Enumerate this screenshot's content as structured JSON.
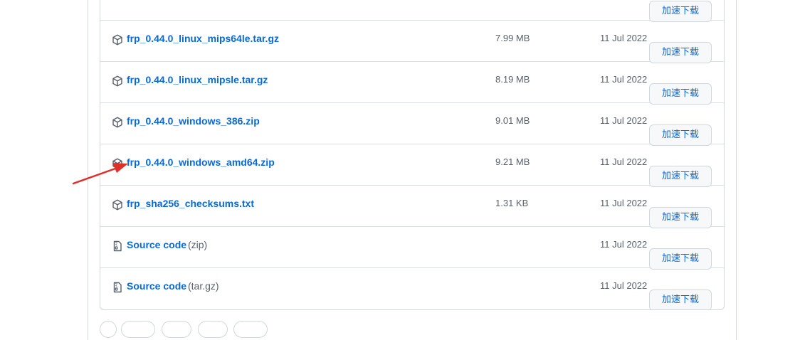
{
  "assets": {
    "partial_top_button_label": "加速下载",
    "rows": [
      {
        "name": "frp_0.44.0_linux_mips64le.tar.gz",
        "size": "7.99 MB",
        "date": "11 Jul 2022",
        "button_label": "加速下载",
        "icon": "package-icon"
      },
      {
        "name": "frp_0.44.0_linux_mipsle.tar.gz",
        "size": "8.19 MB",
        "date": "11 Jul 2022",
        "button_label": "加速下载",
        "icon": "package-icon"
      },
      {
        "name": "frp_0.44.0_windows_386.zip",
        "size": "9.01 MB",
        "date": "11 Jul 2022",
        "button_label": "加速下载",
        "icon": "package-icon"
      },
      {
        "name": "frp_0.44.0_windows_amd64.zip",
        "size": "9.21 MB",
        "date": "11 Jul 2022",
        "button_label": "加速下载",
        "icon": "package-icon"
      },
      {
        "name": "frp_sha256_checksums.txt",
        "size": "1.31 KB",
        "date": "11 Jul 2022",
        "button_label": "加速下载",
        "icon": "package-icon"
      },
      {
        "name": "Source code",
        "ext": "(zip)",
        "date": "11 Jul 2022",
        "button_label": "加速下载",
        "icon": "file-zip-icon"
      },
      {
        "name": "Source code",
        "ext": "(tar.gz)",
        "date": "11 Jul 2022",
        "button_label": "加速下载",
        "icon": "file-zip-icon"
      }
    ]
  },
  "colors": {
    "link": "#0969da",
    "muted": "#57606a",
    "border": "#d0d7de",
    "annotation_arrow": "#e0302a"
  }
}
